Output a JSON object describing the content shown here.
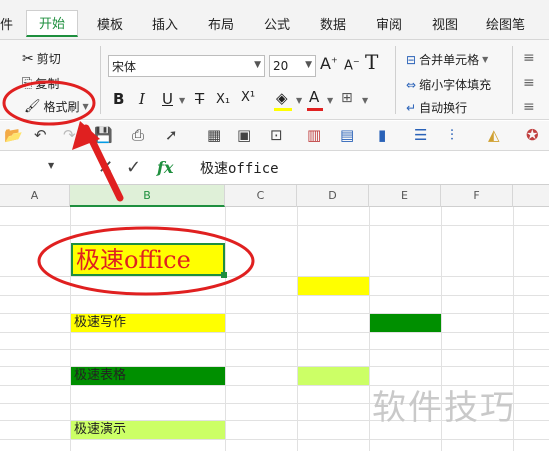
{
  "tabs": [
    {
      "label": "件",
      "active": false
    },
    {
      "label": "开始",
      "active": true
    },
    {
      "label": "模板",
      "active": false
    },
    {
      "label": "插入",
      "active": false
    },
    {
      "label": "布局",
      "active": false
    },
    {
      "label": "公式",
      "active": false
    },
    {
      "label": "数据",
      "active": false
    },
    {
      "label": "审阅",
      "active": false
    },
    {
      "label": "视图",
      "active": false
    },
    {
      "label": "绘图笔",
      "active": false
    }
  ],
  "clipboard": {
    "cut": "剪切",
    "copy": "复制",
    "format_painter": "格式刷"
  },
  "font": {
    "name": "宋体",
    "size": "20"
  },
  "font_size_buttons": {
    "grow": "A",
    "shrink": "A"
  },
  "format_buttons": {
    "bold": "B",
    "italic": "I",
    "underline": "U",
    "strike": "T",
    "subscript": "X₁",
    "superscript": "X¹",
    "font_color": "A"
  },
  "merge": {
    "merge": "合并单元格",
    "shrink": "缩小字体填充",
    "wrap": "自动换行"
  },
  "formula_bar": {
    "fx": "fx",
    "content": "极速office"
  },
  "columns": [
    "A",
    "B",
    "C",
    "D",
    "E",
    "F"
  ],
  "cells": {
    "b_title": "极速office",
    "b_write": "极速写作",
    "b_table": "极速表格",
    "b_demo": "极速演示"
  },
  "watermark": "软件技巧",
  "colors": {
    "accent": "#1e8f3e",
    "yellow": "#ffff00",
    "green": "#008f00",
    "light_green": "#ccff66",
    "annotation_red": "#e02020"
  }
}
